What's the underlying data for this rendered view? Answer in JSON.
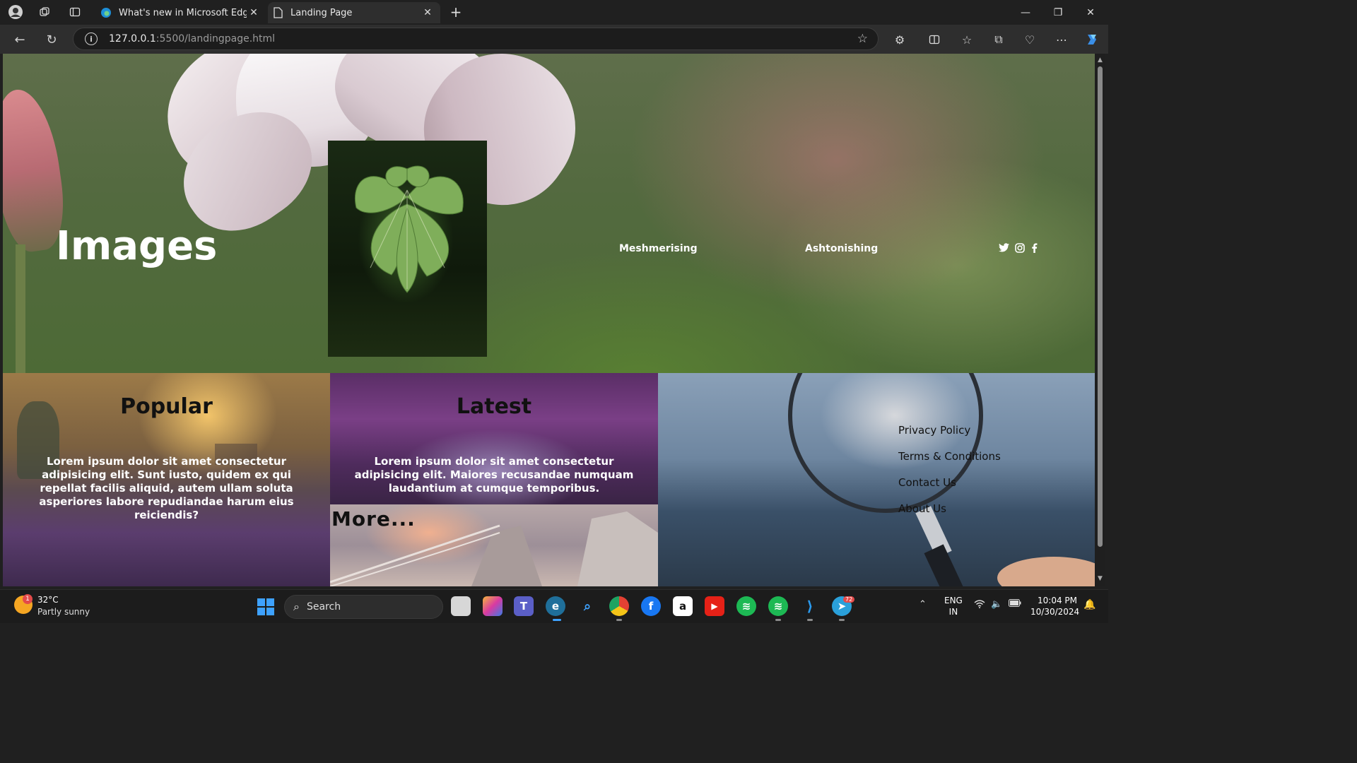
{
  "browser": {
    "tabs": [
      {
        "title": "What's new in Microsoft Edge",
        "active": false
      },
      {
        "title": "Landing Page",
        "active": true
      }
    ],
    "url_host": "127.0.0.1",
    "url_rest": ":5500/landingpage.html"
  },
  "hero": {
    "title": "Images",
    "links": [
      "Meshmerising",
      "Ashtonishing"
    ],
    "social_icons": [
      "twitter-icon",
      "instagram-icon",
      "facebook-icon"
    ]
  },
  "cards": {
    "popular": {
      "heading": "Popular",
      "text": "Lorem ipsum dolor sit amet consectetur adipisicing elit. Sunt iusto, quidem ex qui repellat facilis aliquid, autem ullam soluta asperiores labore repudiandae harum eius reiciendis?"
    },
    "latest": {
      "heading": "Latest",
      "text": "Lorem ipsum dolor sit amet consectetur adipisicing elit. Maiores recusandae numquam laudantium at cumque temporibus."
    },
    "more": {
      "heading": "More..."
    },
    "footer_links": [
      "Privacy Policy",
      "Terms & Conditions",
      "Contact Us",
      "About Us"
    ]
  },
  "taskbar": {
    "weather_temp": "32°C",
    "weather_desc": "Partly sunny",
    "weather_badge": "1",
    "search_label": "Search",
    "telegram_badge": "72",
    "lang_line1": "ENG",
    "lang_line2": "IN",
    "time": "10:04 PM",
    "date": "10/30/2024"
  },
  "colors": {
    "accent": "#3ea2ff",
    "chrome_bg": "#202020",
    "toolbar_bg": "#2e2e2e"
  }
}
